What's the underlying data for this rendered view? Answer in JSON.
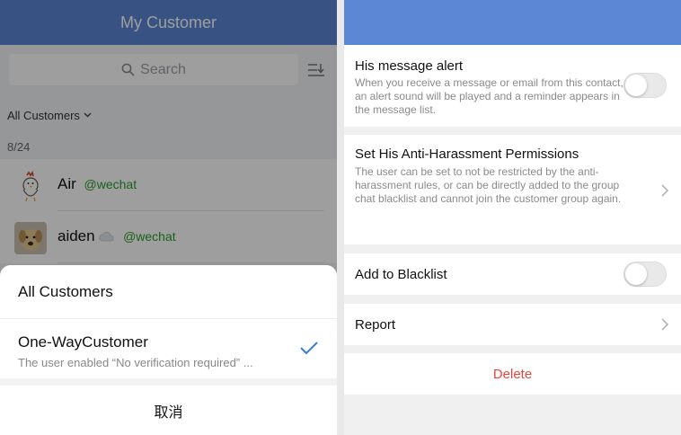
{
  "left": {
    "header_title": "My Customer",
    "search_placeholder": "Search",
    "filter_label": "All Customers",
    "count": "8/24",
    "contacts": [
      {
        "name": "Air",
        "tag": "@wechat"
      },
      {
        "name": "aiden",
        "tag": "@wechat"
      }
    ],
    "sheet": {
      "option1": "All Customers",
      "option2_title": "One-WayCustomer",
      "option2_desc": "The user enabled “No verification required” ...",
      "cancel": "取消"
    }
  },
  "right": {
    "message_alert": {
      "title": "His message alert",
      "desc": "When you receive a message or email from this contact, an alert sound will be played and a reminder appears in the message list.",
      "enabled": false
    },
    "anti_harassment": {
      "title": "Set His Anti-Harassment Permissions",
      "desc": "The user can be set to not be restricted by the anti-harassment rules, or can be directly added to the group chat blacklist and cannot join the customer group again."
    },
    "blacklist": {
      "title": "Add to Blacklist",
      "enabled": false
    },
    "report": {
      "title": "Report"
    },
    "delete_label": "Delete"
  },
  "colors": {
    "header_blue": "#5b87d4",
    "check_blue": "#3a7bd5",
    "tag_green": "#2a9d2a",
    "delete_red": "#e8453c"
  },
  "icons": [
    "search-icon",
    "sort-icon",
    "chevron-down-icon",
    "checkmark-icon",
    "chevron-right-icon",
    "cloud-icon"
  ]
}
